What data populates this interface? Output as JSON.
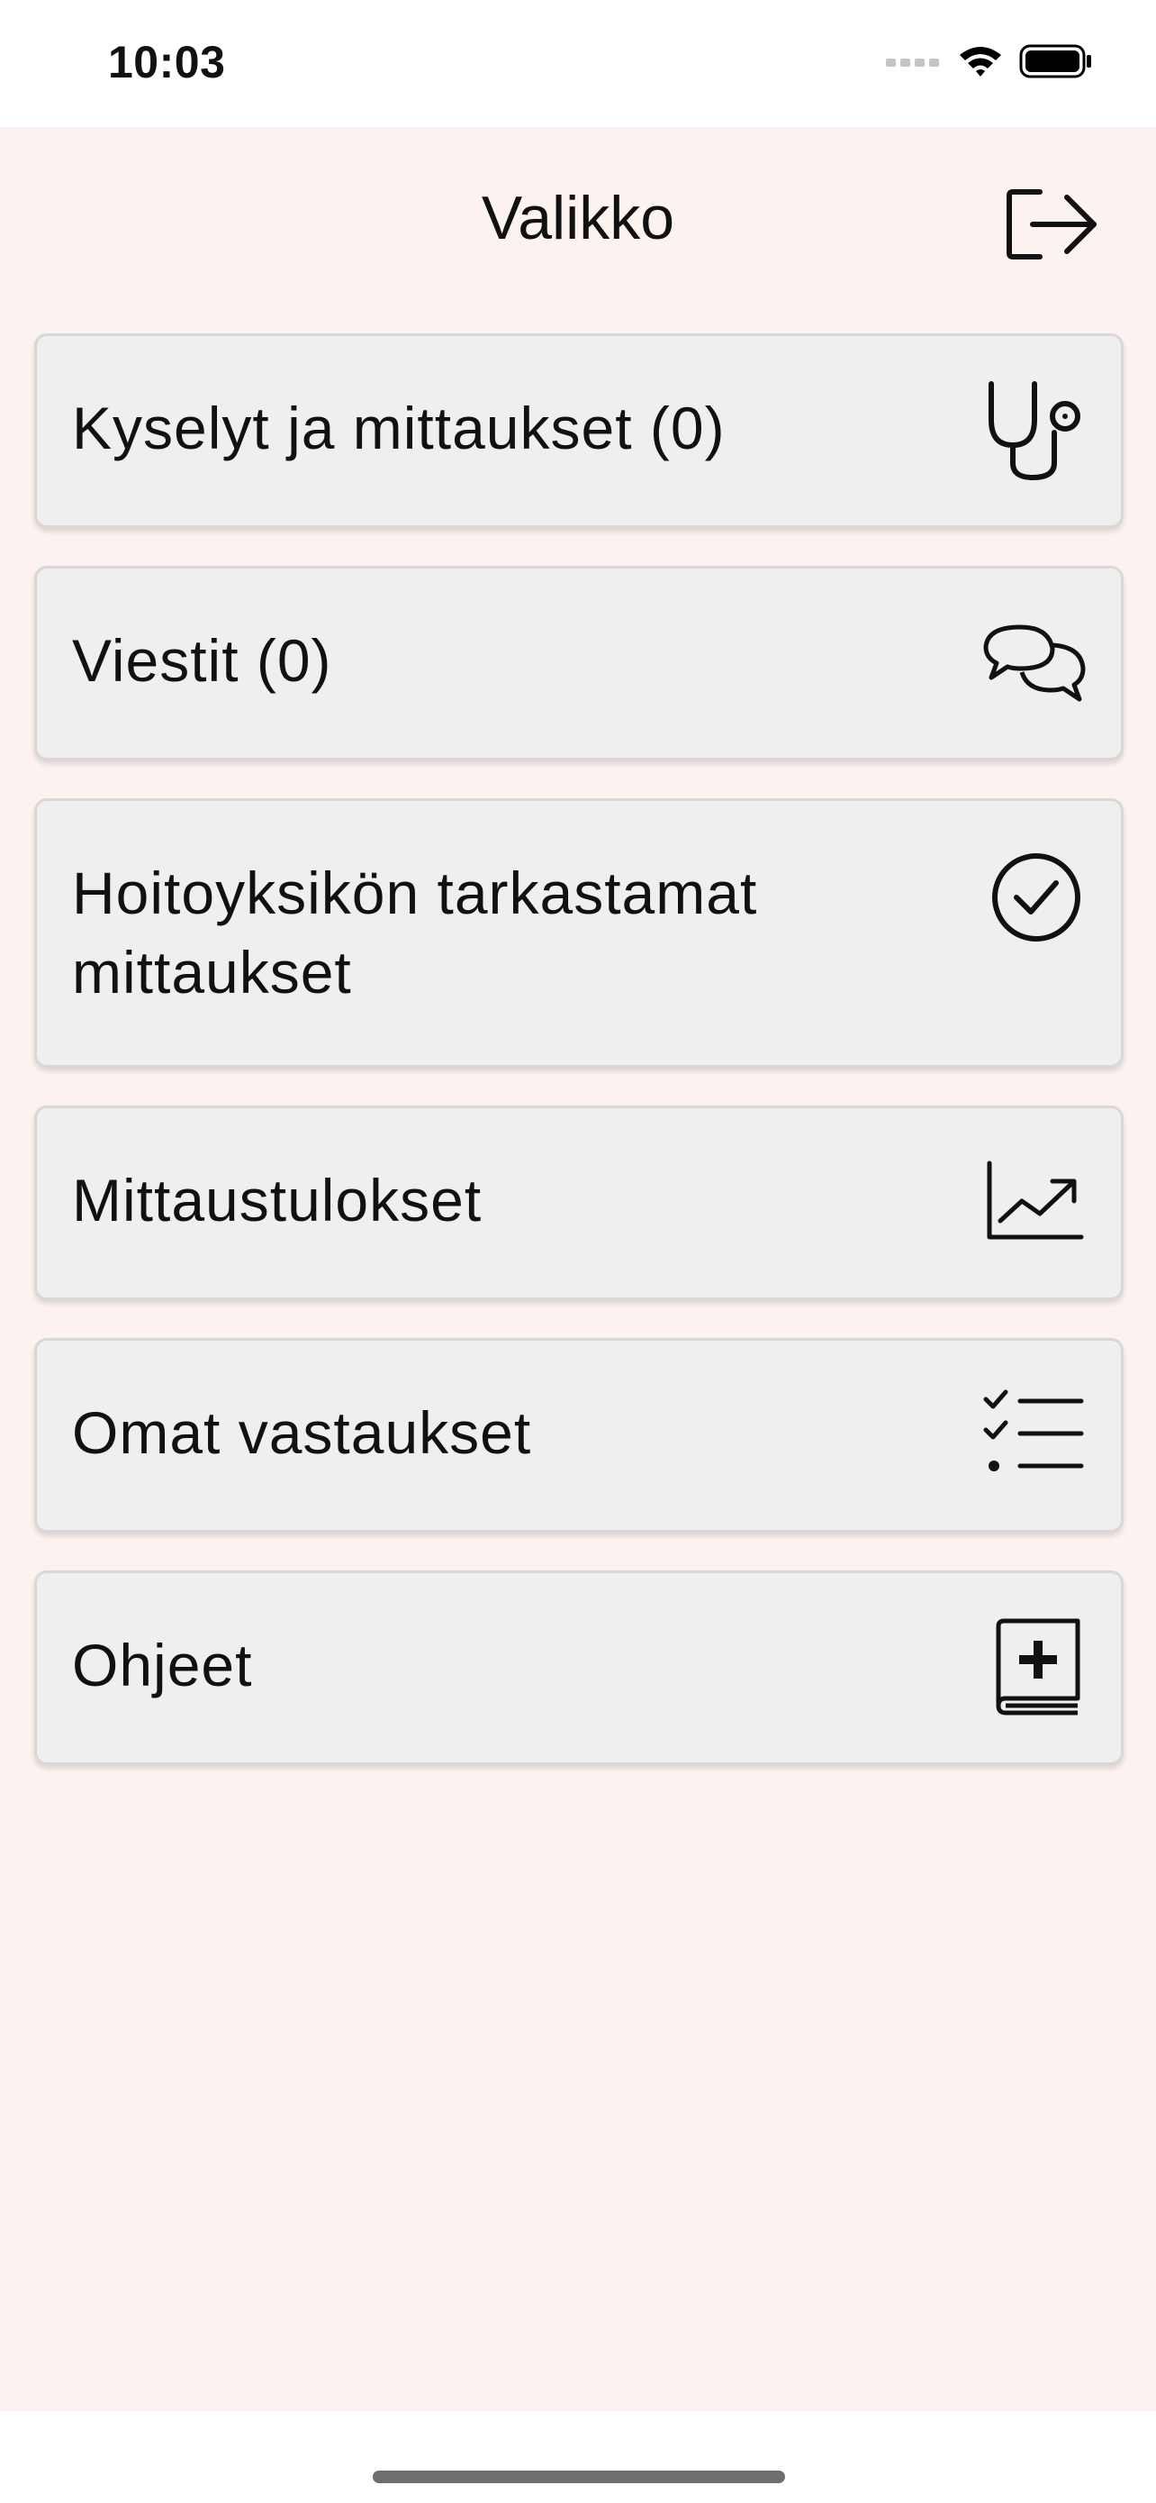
{
  "status_bar": {
    "time": "10:03"
  },
  "header": {
    "title": "Valikko",
    "logout_icon": "logout-icon"
  },
  "menu": {
    "items": [
      {
        "label": "Kyselyt ja mittaukset (0)",
        "icon": "stethoscope-icon"
      },
      {
        "label": "Viestit (0)",
        "icon": "chat-bubbles-icon"
      },
      {
        "label": "Hoitoyksikön tarkastamat mittaukset",
        "icon": "check-circle-icon"
      },
      {
        "label": "Mittaustulokset",
        "icon": "trend-chart-icon"
      },
      {
        "label": "Omat vastaukset",
        "icon": "checklist-icon"
      },
      {
        "label": "Ohjeet",
        "icon": "medical-book-icon"
      }
    ]
  },
  "colors": {
    "background": "#fcf2ef",
    "card": "#efefef",
    "card_border": "#d8d8d8",
    "text": "#111111"
  }
}
